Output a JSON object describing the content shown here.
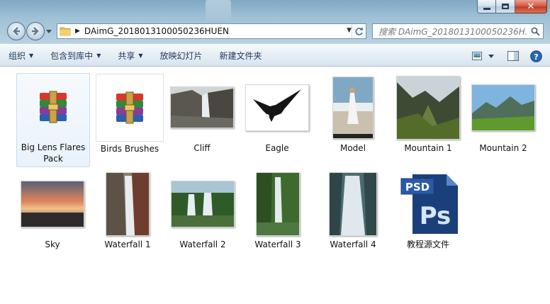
{
  "window": {
    "address_path": "DAimG_2018013100050236HUEN",
    "search_placeholder": "搜索 DAimG_2018013100050236H..."
  },
  "toolbar": {
    "organize": "组织",
    "include_in_library": "包含到库中",
    "share": "共享",
    "slideshow": "放映幻灯片",
    "new_folder": "新建文件夹"
  },
  "icons": {
    "back": "back-arrow-icon",
    "forward": "forward-arrow-icon",
    "folder": "folder-icon",
    "refresh": "refresh-icon",
    "search": "magnifier-icon",
    "view": "view-icon",
    "preview_pane": "preview-pane-icon",
    "help": "help-icon",
    "archive": "winrar-archive-icon",
    "psd": "photoshop-psd-icon"
  },
  "colors": {
    "toolbar_text": "#1e395b",
    "selection_border": "#c7dcef",
    "close_button": "#c23a22"
  },
  "files": [
    {
      "name": "Big Lens Flares Pack",
      "label_line1": "Big Lens Flares",
      "label_line2": "Pack",
      "type": "archive",
      "selected": true
    },
    {
      "name": "Birds Brushes",
      "type": "archive"
    },
    {
      "name": "Cliff",
      "type": "image"
    },
    {
      "name": "Eagle",
      "type": "image"
    },
    {
      "name": "Model",
      "type": "image"
    },
    {
      "name": "Mountain 1",
      "type": "image"
    },
    {
      "name": "Mountain 2",
      "type": "image"
    },
    {
      "name": "Sky",
      "type": "image"
    },
    {
      "name": "Waterfall 1",
      "type": "image"
    },
    {
      "name": "Waterfall 2",
      "type": "image"
    },
    {
      "name": "Waterfall 3",
      "type": "image"
    },
    {
      "name": "Waterfall 4",
      "type": "image"
    },
    {
      "name": "教程源文件",
      "type": "psd",
      "psd_badge": "PSD",
      "psd_letters": "Ps"
    }
  ]
}
